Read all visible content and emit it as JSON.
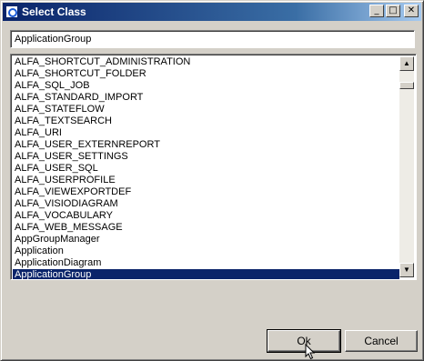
{
  "window": {
    "title": "Select Class",
    "minimize_glyph": "_",
    "maximize_glyph": "□",
    "close_glyph": "✕"
  },
  "search": {
    "value": "ApplicationGroup"
  },
  "list": {
    "items": [
      "ALFA_SHORTCUT_ADMINISTRATION",
      "ALFA_SHORTCUT_FOLDER",
      "ALFA_SQL_JOB",
      "ALFA_STANDARD_IMPORT",
      "ALFA_STATEFLOW",
      "ALFA_TEXTSEARCH",
      "ALFA_URI",
      "ALFA_USER_EXTERNREPORT",
      "ALFA_USER_SETTINGS",
      "ALFA_USER_SQL",
      "ALFA_USERPROFILE",
      "ALFA_VIEWEXPORTDEF",
      "ALFA_VISIODIAGRAM",
      "ALFA_VOCABULARY",
      "ALFA_WEB_MESSAGE",
      "AppGroupManager",
      "Application",
      "ApplicationDiagram",
      "ApplicationGroup"
    ],
    "selected": "ApplicationGroup"
  },
  "buttons": {
    "ok": "Ok",
    "cancel": "Cancel"
  }
}
